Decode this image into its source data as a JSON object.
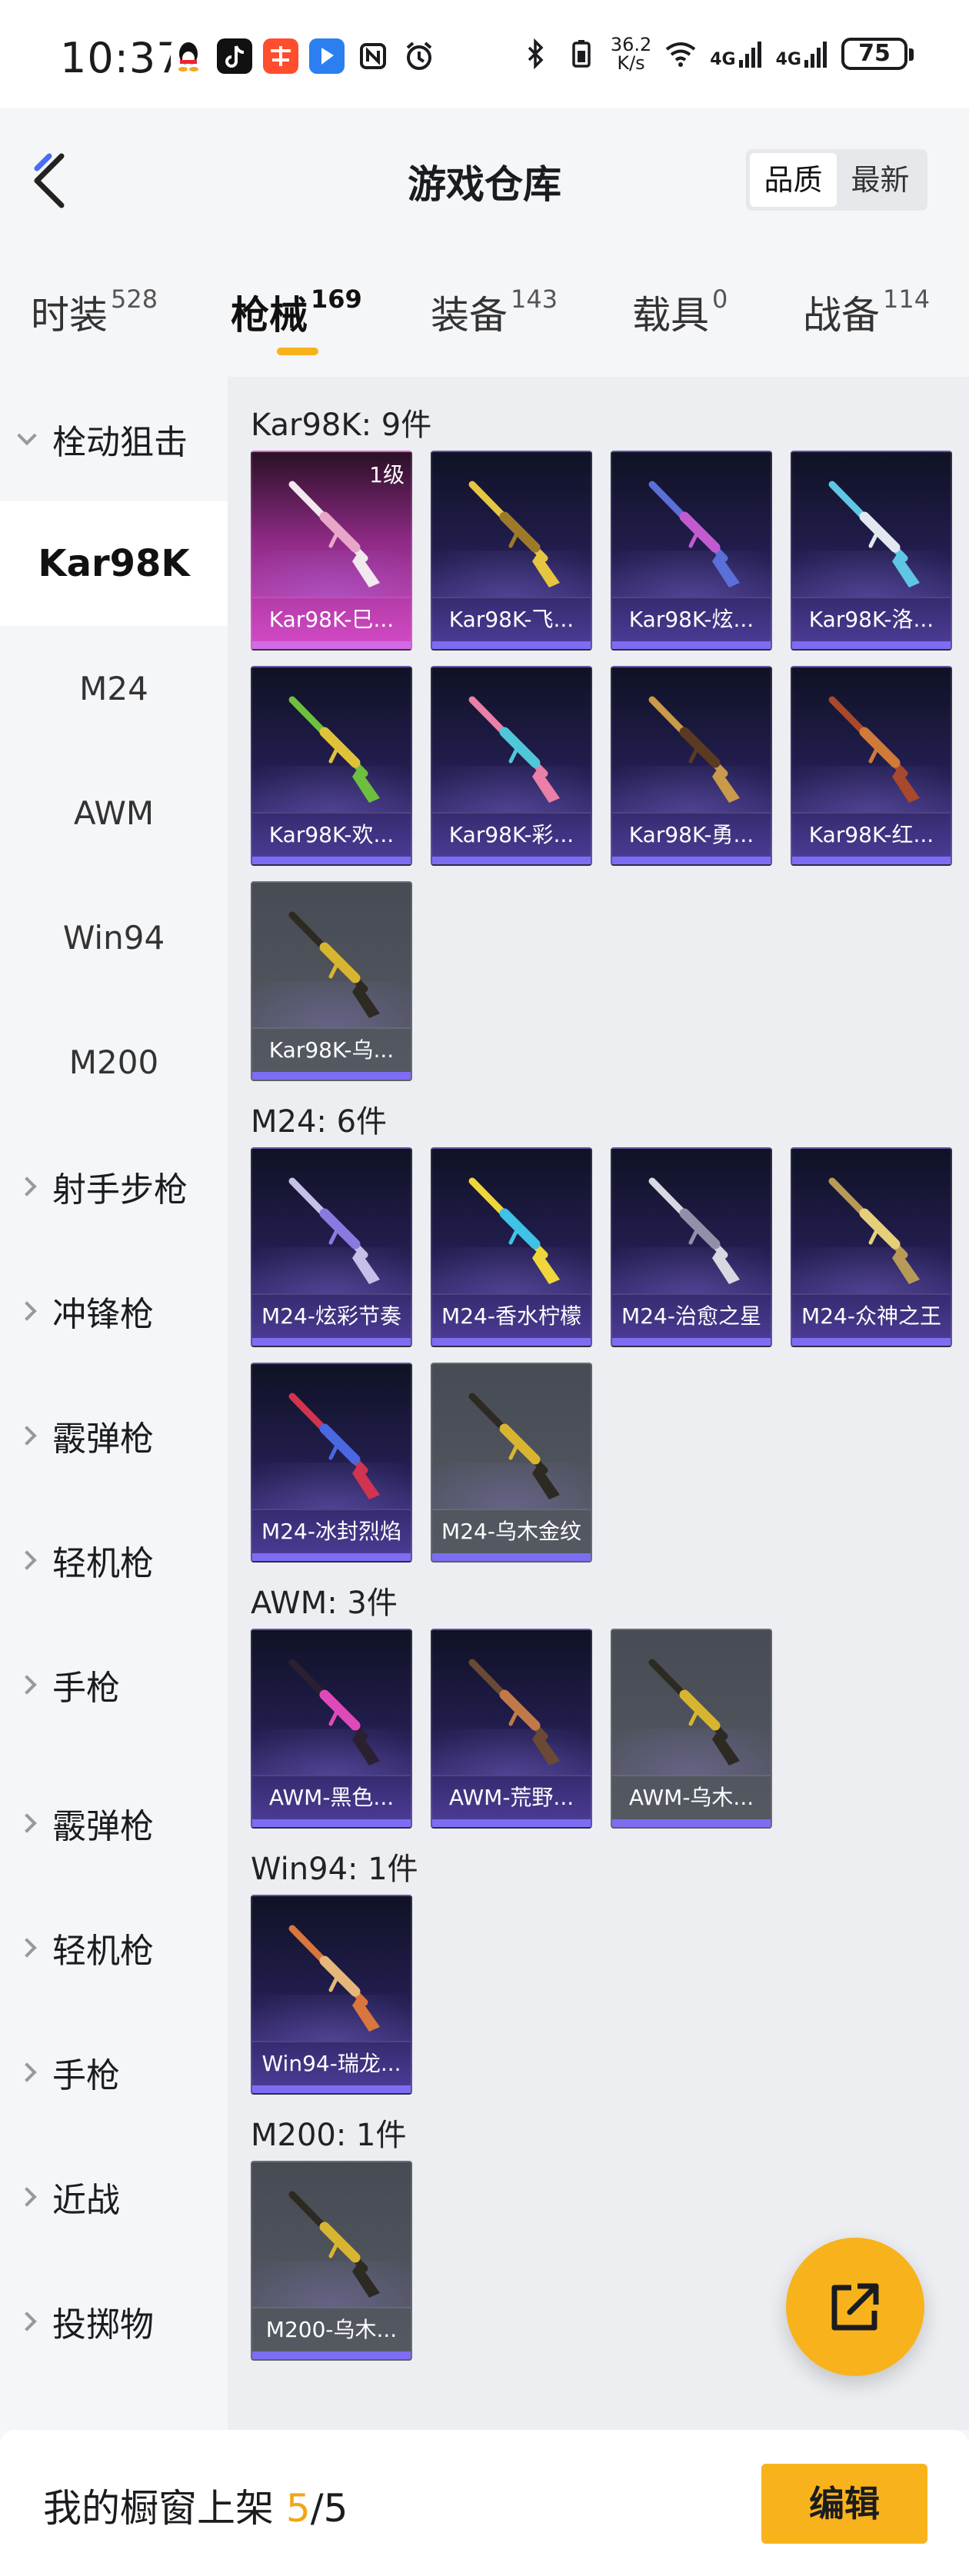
{
  "status_bar": {
    "time": "10:37",
    "net_speed_value": "36.2",
    "net_speed_unit": "K/s",
    "network_1": "4G",
    "network_2": "4G",
    "battery": "75"
  },
  "header": {
    "title": "游戏仓库",
    "sort_options": [
      "品质",
      "最新"
    ],
    "sort_selected": "品质"
  },
  "tabs": [
    {
      "label": "时装",
      "count": "528"
    },
    {
      "label": "枪械",
      "count": "169",
      "active": true
    },
    {
      "label": "装备",
      "count": "143"
    },
    {
      "label": "载具",
      "count": "0"
    },
    {
      "label": "战备",
      "count": "114"
    }
  ],
  "sidebar": {
    "items": [
      {
        "label": "栓动狙击",
        "type": "group",
        "expanded": true
      },
      {
        "label": "Kar98K",
        "type": "sub",
        "selected": true
      },
      {
        "label": "M24",
        "type": "sub"
      },
      {
        "label": "AWM",
        "type": "sub"
      },
      {
        "label": "Win94",
        "type": "sub"
      },
      {
        "label": "M200",
        "type": "sub"
      },
      {
        "label": "射手步枪",
        "type": "group"
      },
      {
        "label": "冲锋枪",
        "type": "group"
      },
      {
        "label": "霰弹枪",
        "type": "group"
      },
      {
        "label": "轻机枪",
        "type": "group"
      },
      {
        "label": "手枪",
        "type": "group"
      },
      {
        "label": "霰弹枪",
        "type": "group"
      },
      {
        "label": "轻机枪",
        "type": "group"
      },
      {
        "label": "手枪",
        "type": "group"
      },
      {
        "label": "近战",
        "type": "group"
      },
      {
        "label": "投掷物",
        "type": "group"
      }
    ]
  },
  "sections": [
    {
      "title": "Kar98K: 9件",
      "items": [
        {
          "label": "Kar98K-巳...",
          "style": "pink",
          "level": "1级",
          "gun_color": "#f2e9ef",
          "accent": "#e8a6c8"
        },
        {
          "label": "Kar98K-飞...",
          "style": "purple",
          "gun_color": "#e6c640",
          "accent": "#9c7a2a"
        },
        {
          "label": "Kar98K-炫...",
          "style": "purple",
          "gun_color": "#5b6fd8",
          "accent": "#c25bd0"
        },
        {
          "label": "Kar98K-洛...",
          "style": "purple",
          "gun_color": "#5fc6e6",
          "accent": "#e1e8f0"
        },
        {
          "label": "Kar98K-欢...",
          "style": "purple",
          "gun_color": "#6fbf3e",
          "accent": "#e0c23a"
        },
        {
          "label": "Kar98K-彩...",
          "style": "purple",
          "gun_color": "#ea7fa8",
          "accent": "#4fc7d8"
        },
        {
          "label": "Kar98K-勇...",
          "style": "purple",
          "gun_color": "#c89a4a",
          "accent": "#5a3b22"
        },
        {
          "label": "Kar98K-红...",
          "style": "purple",
          "gun_color": "#a8482c",
          "accent": "#d07a3a"
        },
        {
          "label": "Kar98K-乌...",
          "style": "grey",
          "gun_color": "#2c2a22",
          "accent": "#d8b530"
        }
      ]
    },
    {
      "title": "M24: 6件",
      "items": [
        {
          "label": "M24-炫彩节奏",
          "style": "purple",
          "gun_color": "#c6c0e8",
          "accent": "#8a7ae0"
        },
        {
          "label": "M24-香水柠檬",
          "style": "purple",
          "gun_color": "#f0d63a",
          "accent": "#3fc3e6"
        },
        {
          "label": "M24-治愈之星",
          "style": "purple",
          "gun_color": "#d8d8e0",
          "accent": "#9090a8"
        },
        {
          "label": "M24-众神之王",
          "style": "purple",
          "gun_color": "#b89a58",
          "accent": "#e6cf7a"
        },
        {
          "label": "M24-冰封烈焰",
          "style": "purple",
          "gun_color": "#d0344e",
          "accent": "#4a68e0"
        },
        {
          "label": "M24-乌木金纹",
          "style": "grey",
          "gun_color": "#2c2a22",
          "accent": "#d8b530"
        }
      ]
    },
    {
      "title": "AWM: 3件",
      "items": [
        {
          "label": "AWM-黑色...",
          "style": "purple",
          "gun_color": "#2a2030",
          "accent": "#e04ab8"
        },
        {
          "label": "AWM-荒野...",
          "style": "purple",
          "gun_color": "#6a4a34",
          "accent": "#c07a4a"
        },
        {
          "label": "AWM-乌木...",
          "style": "grey",
          "gun_color": "#2c2a22",
          "accent": "#d8b530"
        }
      ]
    },
    {
      "title": "Win94: 1件",
      "items": [
        {
          "label": "Win94-瑞龙...",
          "style": "purple",
          "gun_color": "#d8763e",
          "accent": "#e6b77a"
        }
      ]
    },
    {
      "title": "M200: 1件",
      "items": [
        {
          "label": "M200-乌木...",
          "style": "grey",
          "gun_color": "#2c2a22",
          "accent": "#d8b530"
        }
      ]
    }
  ],
  "bottom_bar": {
    "text_prefix": "我的橱窗上架 ",
    "count_current": "5",
    "count_sep": "/",
    "count_total": "5",
    "edit_label": "编辑"
  },
  "colors": {
    "accent_yellow": "#f8b31c",
    "card_purple": "#241e52",
    "card_pink": "#d54bc8",
    "card_grey": "#555962"
  }
}
